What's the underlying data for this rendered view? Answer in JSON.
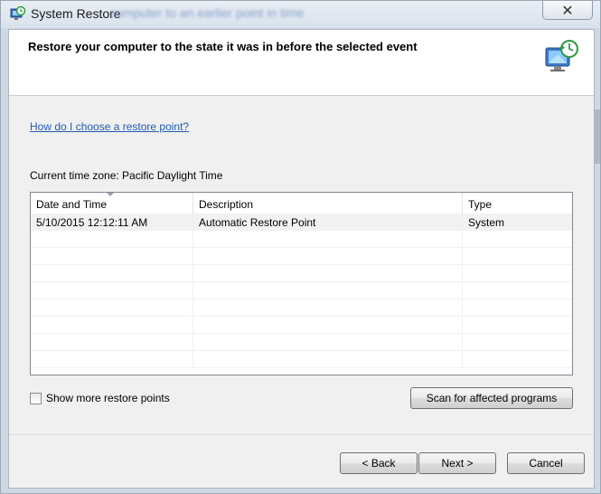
{
  "window": {
    "title": "System Restore",
    "background_blur_text": "computer to an earlier point in time",
    "close_glyph": "✕"
  },
  "header": {
    "title": "Restore your computer to the state it was in before the selected event"
  },
  "help_link": "How do I choose a restore point?",
  "timezone_label": "Current time zone: Pacific Daylight Time",
  "restore_points": {
    "columns": [
      "Date and Time",
      "Description",
      "Type"
    ],
    "rows": [
      {
        "date": "5/10/2015 12:12:11 AM",
        "description": "Automatic Restore Point",
        "type": "System"
      },
      {
        "date": "",
        "description": "",
        "type": ""
      },
      {
        "date": "",
        "description": "",
        "type": ""
      },
      {
        "date": "",
        "description": "",
        "type": ""
      },
      {
        "date": "",
        "description": "",
        "type": ""
      },
      {
        "date": "",
        "description": "",
        "type": ""
      },
      {
        "date": "",
        "description": "",
        "type": ""
      },
      {
        "date": "",
        "description": "",
        "type": ""
      },
      {
        "date": "",
        "description": "",
        "type": ""
      }
    ]
  },
  "show_more_checkbox": {
    "label": "Show more restore points",
    "checked": false
  },
  "scan_button": "Scan for affected programs",
  "footer": {
    "back_label": "< Back",
    "next_label": "Next >",
    "cancel_label": "Cancel"
  },
  "icons": {
    "app": "system-restore-icon",
    "header": "restore-monitor-icon",
    "sort": "sort-descending-icon"
  },
  "colors": {
    "link": "#1f5bb3",
    "window_frame": "#cfd9e4",
    "client_bg": "#f0f0f0"
  }
}
